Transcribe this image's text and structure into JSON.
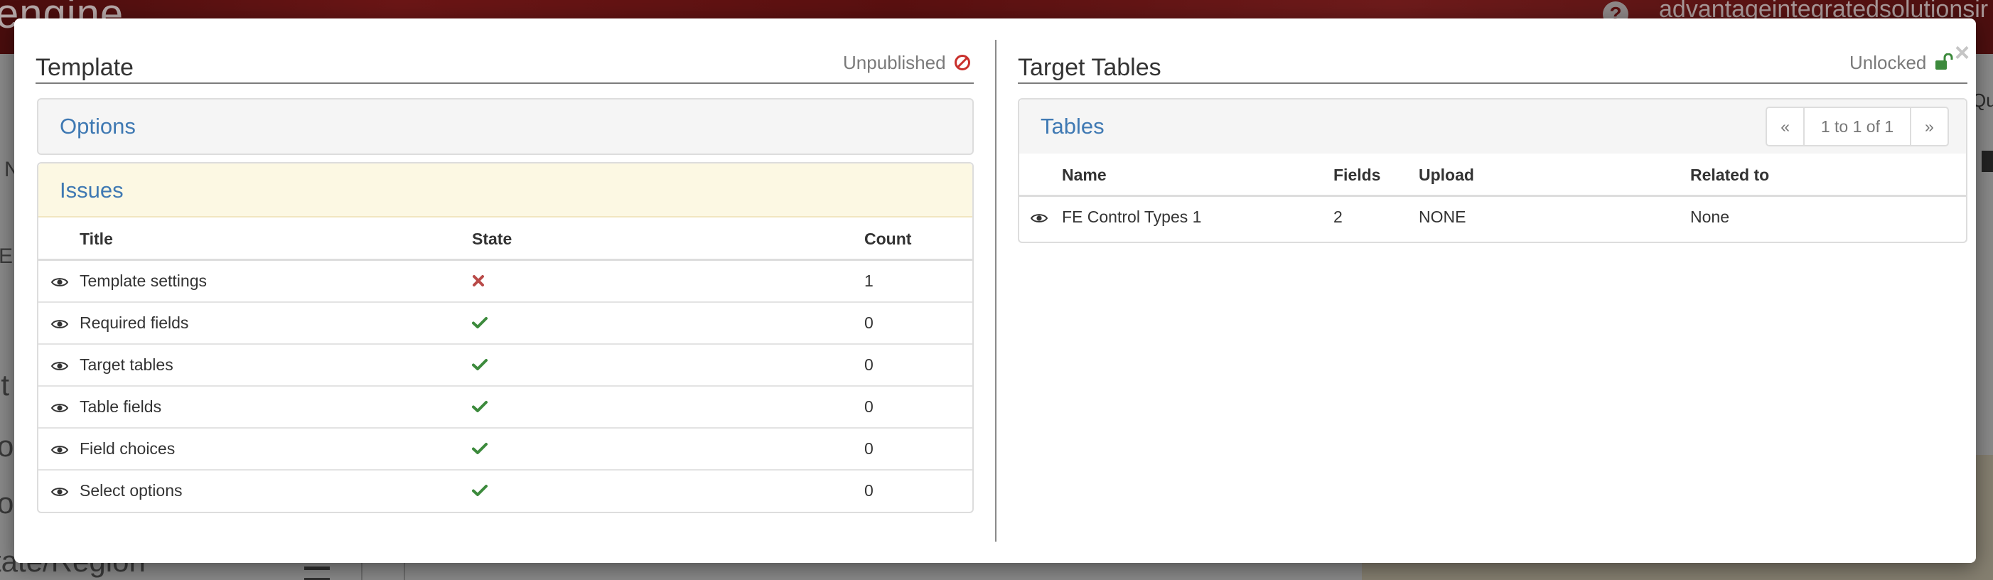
{
  "background": {
    "logo": "engine",
    "account": "advantageintegratedsolutionsir",
    "help_glyph": "?",
    "fragments": [
      "N",
      "E",
      "it",
      "o",
      "o",
      "tate/Region",
      "Qu"
    ]
  },
  "modal": {
    "close_glyph": "×",
    "template": {
      "title": "Template",
      "status": "Unpublished",
      "status_icon": "ban-icon",
      "options_heading": "Options",
      "issues": {
        "heading": "Issues",
        "columns": [
          "Title",
          "State",
          "Count"
        ],
        "rows": [
          {
            "title": "Template settings",
            "state": "error",
            "count": "1"
          },
          {
            "title": "Required fields",
            "state": "ok",
            "count": "0"
          },
          {
            "title": "Target tables",
            "state": "ok",
            "count": "0"
          },
          {
            "title": "Table fields",
            "state": "ok",
            "count": "0"
          },
          {
            "title": "Field choices",
            "state": "ok",
            "count": "0"
          },
          {
            "title": "Select options",
            "state": "ok",
            "count": "0"
          }
        ]
      }
    },
    "target_tables": {
      "title": "Target Tables",
      "status": "Unlocked",
      "status_icon": "unlock-icon",
      "tables": {
        "heading": "Tables",
        "pager": {
          "prev": "«",
          "range": "1 to 1 of 1",
          "next": "»"
        },
        "columns": [
          "Name",
          "Fields",
          "Upload",
          "Related to"
        ],
        "rows": [
          {
            "name": "FE Control Types 1",
            "fields": "2",
            "upload": "NONE",
            "related_to": "None"
          }
        ]
      }
    }
  },
  "colors": {
    "link_blue": "#3f79b3",
    "issues_bg": "#fcf8e3",
    "ok_green": "#3c8a3c",
    "error_red": "#b94a48",
    "unpublished_red": "#c9302c",
    "unlocked_green": "#3c8a3c"
  }
}
